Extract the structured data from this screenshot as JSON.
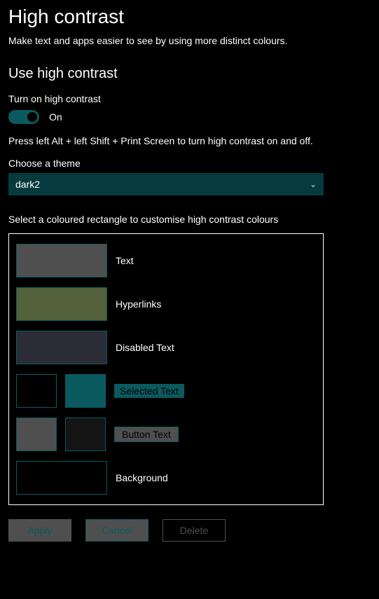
{
  "page": {
    "title": "High contrast",
    "description": "Make text and apps easier to see by using more distinct colours."
  },
  "section": {
    "heading": "Use high contrast",
    "toggle_label": "Turn on high contrast",
    "toggle_state": "On",
    "shortcut_hint": "Press left Alt + left Shift + Print Screen to turn high contrast on and off.",
    "theme_label": "Choose a theme",
    "theme_value": "dark2",
    "swatch_hint": "Select a coloured rectangle to customise high contrast colours"
  },
  "swatches": {
    "text": {
      "label": "Text",
      "color": "#4f4f4f"
    },
    "hyperlinks": {
      "label": "Hyperlinks",
      "color": "#53623b"
    },
    "disabled": {
      "label": "Disabled Text",
      "color": "#2b2c36"
    },
    "selected": {
      "label": "Selected Text",
      "fg": "#000000",
      "bg": "#0a5a5f"
    },
    "button": {
      "label": "Button Text",
      "fg": "#4f4f4f",
      "bg": "#141414"
    },
    "background": {
      "label": "Background",
      "color": "#000000"
    }
  },
  "buttons": {
    "apply": "Apply",
    "cancel": "Cancel",
    "delete": "Delete"
  },
  "colors": {
    "accent": "#0a5a5f"
  }
}
